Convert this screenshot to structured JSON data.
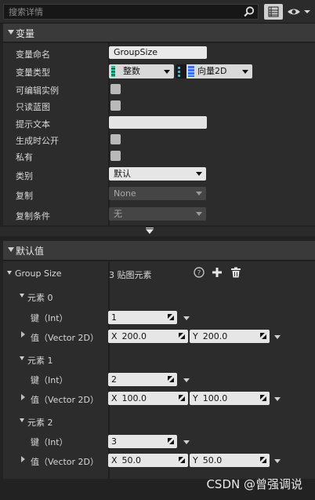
{
  "search": {
    "placeholder": "搜索详情"
  },
  "variable_section": {
    "title": "变量",
    "rows": {
      "name": {
        "label": "变量命名",
        "value": "GroupSize"
      },
      "type": {
        "label": "变量类型",
        "key_type": "整数",
        "value_type": "向量2D"
      },
      "editable": {
        "label": "可编辑实例"
      },
      "readonly": {
        "label": "只读蓝图"
      },
      "tooltip": {
        "label": "提示文本",
        "value": ""
      },
      "expose": {
        "label": "生成时公开"
      },
      "private": {
        "label": "私有"
      },
      "category": {
        "label": "类别",
        "value": "默认"
      },
      "replication": {
        "label": "复制",
        "value": "None"
      },
      "repcondition": {
        "label": "复制条件",
        "value": "无"
      }
    }
  },
  "default_section": {
    "title": "默认值",
    "map": {
      "label": "Group Size",
      "summary": "3 贴图元素"
    },
    "elements": [
      {
        "title": "元素 0",
        "key_label": "键（Int）",
        "key": "1",
        "value_label": "值（Vector 2D）",
        "x": "200.0",
        "y": "200.0"
      },
      {
        "title": "元素 1",
        "key_label": "键（Int）",
        "key": "2",
        "value_label": "值（Vector 2D）",
        "x": "100.0",
        "y": "100.0"
      },
      {
        "title": "元素 2",
        "key_label": "键（Int）",
        "key": "3",
        "value_label": "值（Vector 2D）",
        "x": "50.0",
        "y": "50.0"
      }
    ],
    "x_label": "X",
    "y_label": "Y"
  },
  "watermark": "CSDN @曾强调说",
  "colors": {
    "int_pin": "#2fb59a",
    "vector2d_pin": "#3c6cf0",
    "panel": "#2c2c2c"
  }
}
